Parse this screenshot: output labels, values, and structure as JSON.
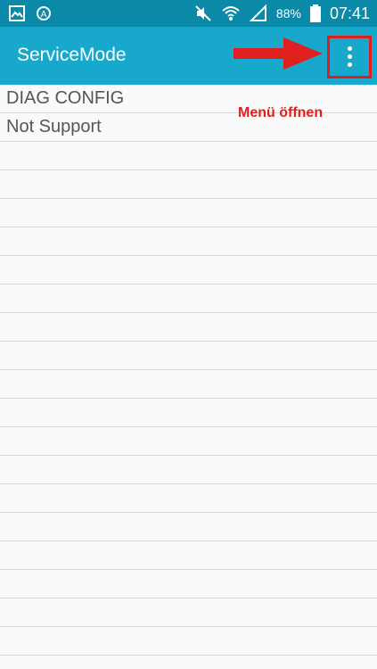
{
  "status_bar": {
    "battery_percent": "88%",
    "time": "07:41",
    "icons": [
      "image-icon",
      "at-sign-icon",
      "mute-icon",
      "wifi-icon",
      "signal-icon",
      "battery-icon"
    ]
  },
  "app_bar": {
    "title": "ServiceMode",
    "menu_icon": "overflow-menu-icon"
  },
  "list": {
    "items": [
      "DIAG CONFIG",
      "Not Support"
    ]
  },
  "annotation": {
    "text": "Menü öffnen",
    "color": "#e0201e"
  },
  "colors": {
    "status_bar": "#0a8aa8",
    "app_bar": "#18a8cc",
    "text": "#555555",
    "divider": "#d7d7d7"
  }
}
